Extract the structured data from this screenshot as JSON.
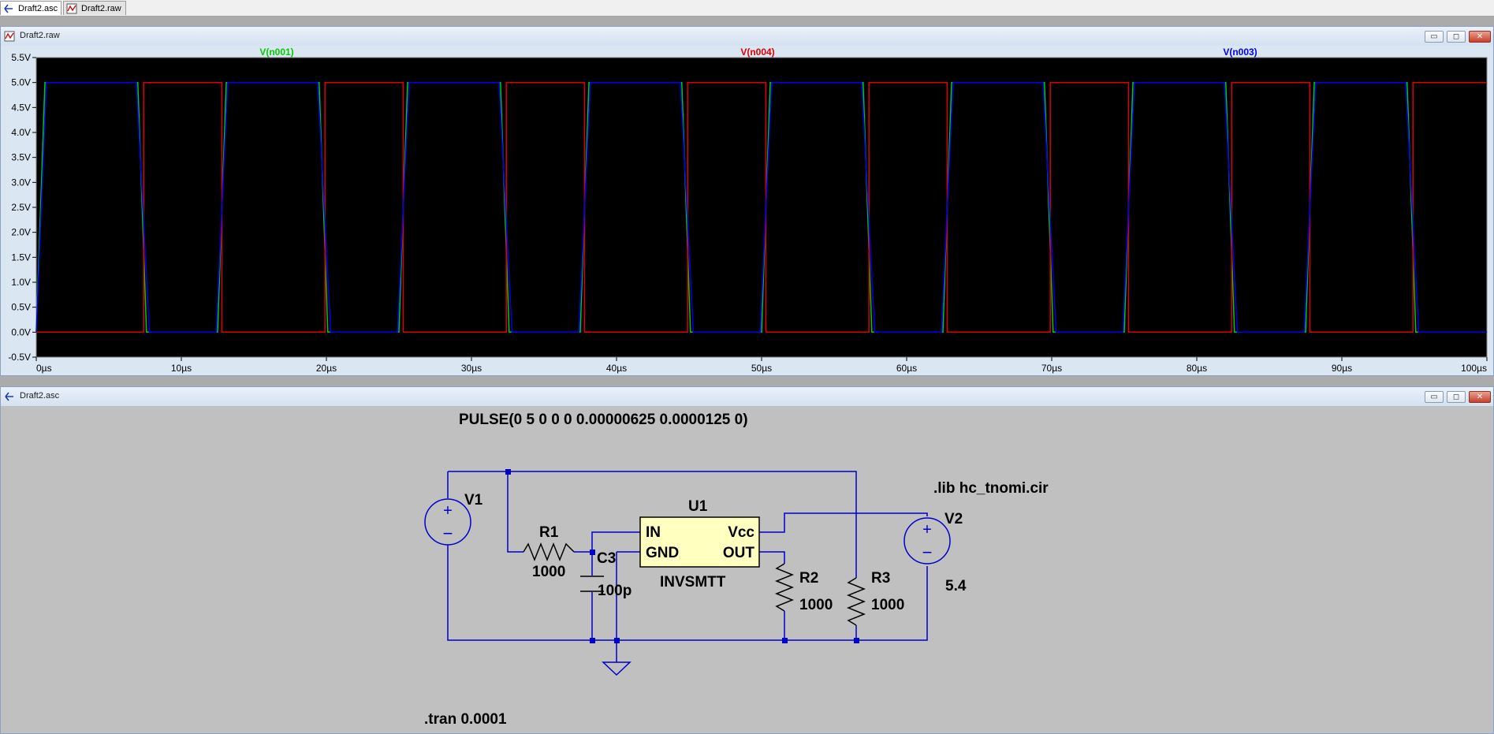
{
  "tabs": [
    {
      "label": "Draft2.asc",
      "icon": "schematic-icon",
      "active": true
    },
    {
      "label": "Draft2.raw",
      "icon": "waveform-icon",
      "active": false
    }
  ],
  "waveform_window": {
    "title": "Draft2.raw",
    "buttons": {
      "minimize": "▭",
      "maximize": "◻",
      "close": "✕"
    },
    "chart_data": {
      "type": "line",
      "title": "",
      "xlabel": "",
      "ylabel": "",
      "xlim": [
        0,
        100
      ],
      "ylim": [
        -0.5,
        5.5
      ],
      "x_ticks": [
        "0µs",
        "10µs",
        "20µs",
        "30µs",
        "40µs",
        "50µs",
        "60µs",
        "70µs",
        "80µs",
        "90µs",
        "100µs"
      ],
      "y_ticks": [
        "5.5V",
        "5.0V",
        "4.5V",
        "4.0V",
        "3.5V",
        "3.0V",
        "2.5V",
        "2.0V",
        "1.5V",
        "1.0V",
        "0.5V",
        "0.0V",
        "-0.5V"
      ],
      "grid": false,
      "background": "#000000",
      "series": [
        {
          "name": "V(n001)",
          "color": "#00cc00",
          "x": [
            0,
            0.6,
            7.0,
            7.6,
            12.5,
            13.1,
            19.5,
            20.1,
            25.0,
            25.6,
            32.0,
            32.6,
            37.5,
            38.1,
            44.5,
            45.1,
            50.0,
            50.6,
            57.0,
            57.6,
            62.5,
            63.1,
            69.5,
            70.1,
            75.0,
            75.6,
            82.0,
            82.6,
            87.5,
            88.1,
            94.5,
            95.1,
            100
          ],
          "y": [
            0,
            5,
            5,
            0,
            0,
            5,
            5,
            0,
            0,
            5,
            5,
            0,
            0,
            5,
            5,
            0,
            0,
            5,
            5,
            0,
            0,
            5,
            5,
            0,
            0,
            5,
            5,
            0,
            0,
            5,
            5,
            0,
            0
          ]
        },
        {
          "name": "V(n004)",
          "color": "#dd0000",
          "x": [
            0,
            0,
            7.4,
            7.4,
            12.8,
            12.8,
            19.9,
            19.9,
            25.3,
            25.3,
            32.4,
            32.4,
            37.8,
            37.8,
            44.9,
            44.9,
            50.3,
            50.3,
            57.4,
            57.4,
            62.8,
            62.8,
            69.9,
            69.9,
            75.3,
            75.3,
            82.4,
            82.4,
            87.8,
            87.8,
            94.9,
            94.9,
            100
          ],
          "y": [
            0,
            0,
            0,
            5,
            5,
            0,
            0,
            5,
            5,
            0,
            0,
            5,
            5,
            0,
            0,
            5,
            5,
            0,
            0,
            5,
            5,
            0,
            0,
            5,
            5,
            0,
            0,
            5,
            5,
            0,
            0,
            5,
            5
          ]
        },
        {
          "name": "V(n003)",
          "color": "#0000ee",
          "x": [
            0,
            0.7,
            6.9,
            7.8,
            12.4,
            13.2,
            19.4,
            20.3,
            24.9,
            25.7,
            31.9,
            32.8,
            37.4,
            38.2,
            44.4,
            45.3,
            49.9,
            50.7,
            56.9,
            57.8,
            62.4,
            63.2,
            69.4,
            70.3,
            74.9,
            75.7,
            81.9,
            82.8,
            87.4,
            88.2,
            94.4,
            95.3,
            100
          ],
          "y": [
            0,
            5,
            5,
            0,
            0,
            5,
            5,
            0,
            0,
            5,
            5,
            0,
            0,
            5,
            5,
            0,
            0,
            5,
            5,
            0,
            0,
            5,
            5,
            0,
            0,
            5,
            5,
            0,
            0,
            5,
            5,
            0,
            0
          ]
        }
      ]
    }
  },
  "schematic_window": {
    "title": "Draft2.asc",
    "buttons": {
      "minimize": "▭",
      "maximize": "◻",
      "close": "✕"
    },
    "pulse_directive": "PULSE(0 5 0 0 0 0.00000625 0.0000125 0)",
    "lib_directive": ".lib hc_tnomi.cir",
    "tran_directive": ".tran 0.0001",
    "components": {
      "v1": {
        "name": "V1"
      },
      "v2": {
        "name": "V2",
        "value": "5.4"
      },
      "r1": {
        "name": "R1",
        "value": "1000"
      },
      "r2": {
        "name": "R2",
        "value": "1000"
      },
      "r3": {
        "name": "R3",
        "value": "1000"
      },
      "c3": {
        "name": "C3",
        "value": "100p"
      },
      "u1": {
        "name": "U1",
        "model": "INVSMTT",
        "pins": {
          "in": "IN",
          "gnd": "GND",
          "vcc": "Vcc",
          "out": "OUT"
        }
      }
    },
    "colors": {
      "wire": "#0000cc",
      "background": "#c0c0c0",
      "ic_fill": "#ffffc0"
    }
  }
}
